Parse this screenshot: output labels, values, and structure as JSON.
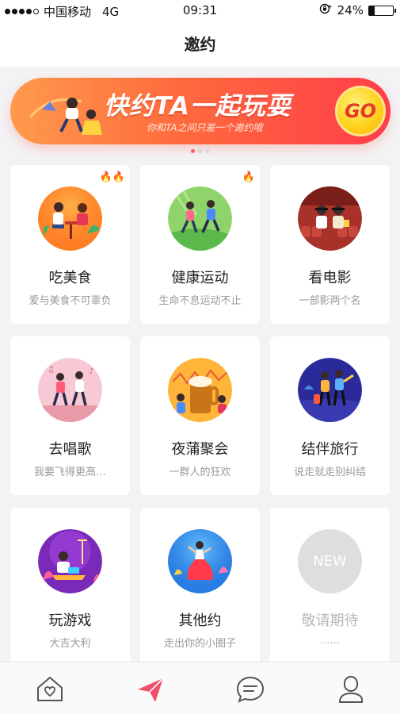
{
  "status_bar": {
    "carrier": "中国移动",
    "network": "4G",
    "time": "09:31",
    "battery_percent": "24%",
    "battery_level": 0.24
  },
  "header": {
    "title": "邀约"
  },
  "banner": {
    "title": "快约TA一起玩耍",
    "subtitle": "你和TA之间只差一个邀约哦",
    "go_label": "GO",
    "page_count": 3,
    "active_page": 0
  },
  "categories": [
    {
      "name": "吃美食",
      "desc": "爱与美食不可辜负",
      "hot": "🔥🔥",
      "icon": "dining-couple-icon"
    },
    {
      "name": "健康运动",
      "desc": "生命不息运动不止",
      "hot": "🔥",
      "icon": "running-couple-icon"
    },
    {
      "name": "看电影",
      "desc": "一部影两个名",
      "hot": "",
      "icon": "movie-theater-icon"
    },
    {
      "name": "去唱歌",
      "desc": "我要飞得更高…",
      "hot": "",
      "icon": "singing-couple-icon"
    },
    {
      "name": "夜蒲聚会",
      "desc": "一群人的狂欢",
      "hot": "",
      "icon": "party-beer-icon"
    },
    {
      "name": "结伴旅行",
      "desc": "说走就走别纠结",
      "hot": "",
      "icon": "travel-couple-icon"
    },
    {
      "name": "玩游戏",
      "desc": "大吉大利",
      "hot": "",
      "icon": "gaming-icon"
    },
    {
      "name": "其他约",
      "desc": "走出你的小圈子",
      "hot": "",
      "icon": "dancing-woman-icon"
    },
    {
      "name": "敬请期待",
      "desc": "......",
      "hot": "",
      "icon": "new-placeholder-icon",
      "badge": "NEW"
    }
  ],
  "tabbar": {
    "items": [
      {
        "icon": "home-heart-icon",
        "active": false
      },
      {
        "icon": "paper-plane-icon",
        "active": true
      },
      {
        "icon": "chat-bubble-icon",
        "active": false
      },
      {
        "icon": "profile-icon",
        "active": false
      }
    ]
  },
  "colors": {
    "accent": "#f0506a",
    "banner_start": "#ff9a4c",
    "banner_end": "#ff3d4a",
    "go_yellow": "#ffd21f"
  }
}
